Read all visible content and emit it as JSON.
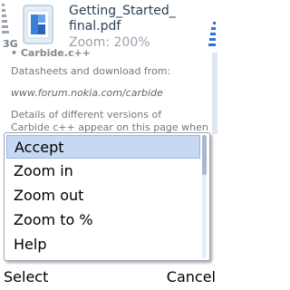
{
  "status": {
    "network": "3G"
  },
  "document": {
    "title_line1": "Getting_Started_",
    "title_line2": "final.pdf",
    "zoom_label": "Zoom: 200%"
  },
  "page": {
    "lines": [
      "• Carbide.c++",
      "Datasheets and download from:",
      "www.forum.nokia.com/carbide",
      "Details of different versions of",
      "Carbide c++ appear on this page when"
    ]
  },
  "menu": {
    "items": [
      "Accept",
      "Zoom in",
      "Zoom out",
      "Zoom to %",
      "Help"
    ],
    "selected_index": 0
  },
  "softkeys": {
    "left": "Select",
    "right": "Cancel"
  },
  "colors": {
    "selection": "#c7d9f2",
    "title": "#2d3e57",
    "accent": "#2b73d6"
  }
}
